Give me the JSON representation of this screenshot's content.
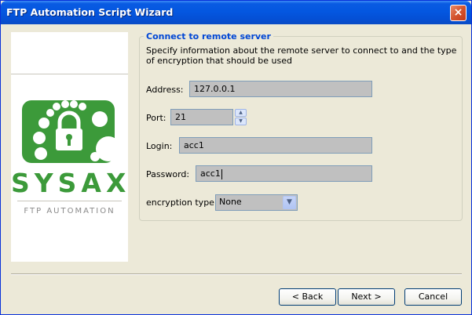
{
  "window": {
    "title": "FTP Automation Script Wizard",
    "close_glyph": "×"
  },
  "branding": {
    "logo_text": "SYSAX",
    "logo_subtitle": "FTP AUTOMATION",
    "logo_icon": "lock-icon",
    "logo_color": "#3c9a3a"
  },
  "section": {
    "title": "Connect to remote server",
    "description": "Specify information about the remote server to connect to and the type of encryption that should be used"
  },
  "form": {
    "address": {
      "label": "Address:",
      "value": "127.0.0.1"
    },
    "port": {
      "label": "Port:",
      "value": "21"
    },
    "login": {
      "label": "Login:",
      "value": "acc1"
    },
    "password": {
      "label": "Password:",
      "value": "acc1"
    },
    "encryption": {
      "label": "encryption type:",
      "value": "None"
    }
  },
  "buttons": {
    "back": "< Back",
    "next": "Next >",
    "cancel": "Cancel"
  },
  "colors": {
    "title_bar": "#0457e0",
    "section_title": "#0046d5",
    "dialog_bg": "#ece9d8"
  }
}
